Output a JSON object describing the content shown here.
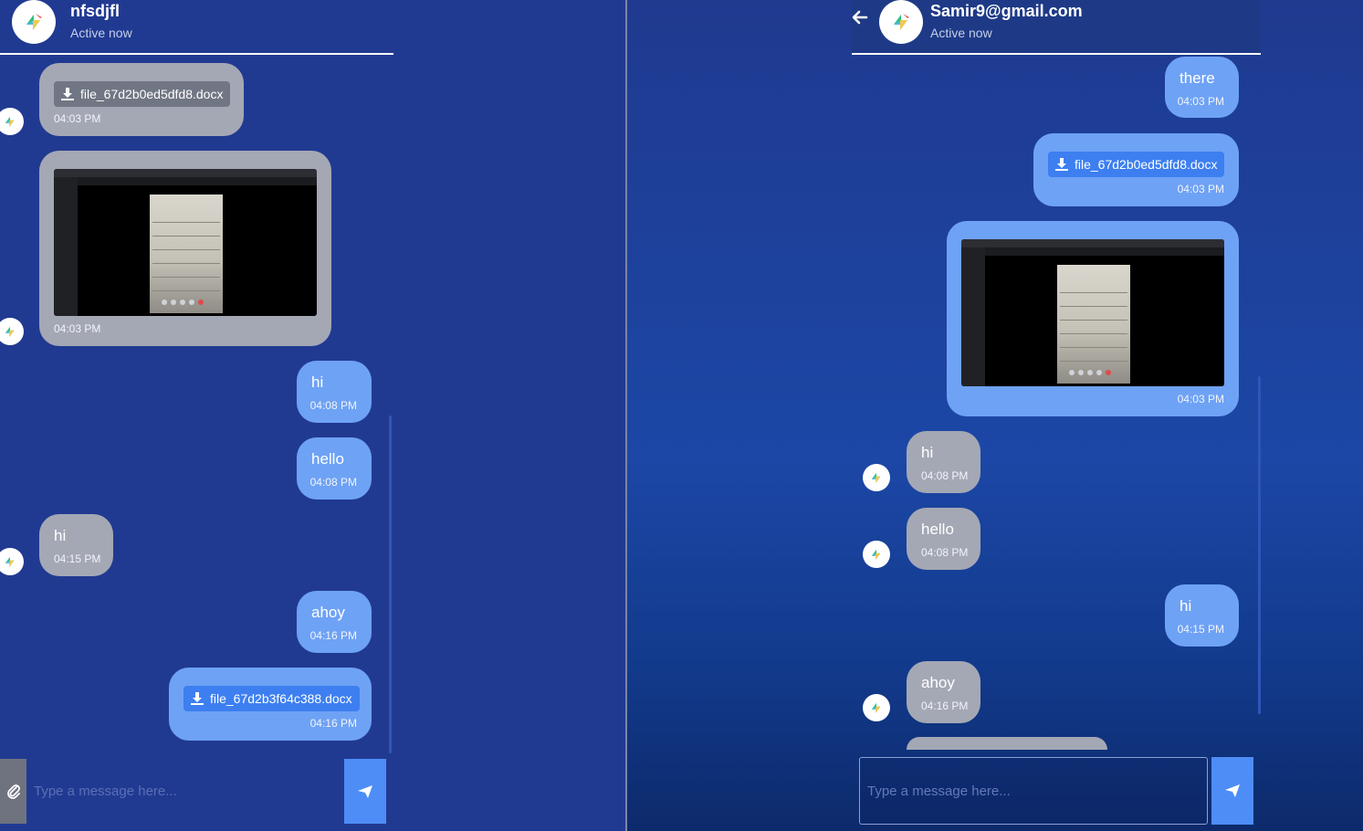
{
  "left": {
    "header": {
      "name": "nfsdjfl",
      "status": "Active now"
    },
    "composer": {
      "placeholder": "Type a message here..."
    },
    "messages": [
      {
        "file": "file_67d2b0ed5dfd8.docx",
        "time": "04:03 PM"
      },
      {
        "time": "04:03 PM"
      },
      {
        "text": "hi",
        "time": "04:08 PM"
      },
      {
        "text": "hello",
        "time": "04:08 PM"
      },
      {
        "text": "hi",
        "time": "04:15 PM"
      },
      {
        "text": "ahoy",
        "time": "04:16 PM"
      },
      {
        "file": "file_67d2b3f64c388.docx",
        "time": "04:16 PM"
      }
    ]
  },
  "right": {
    "header": {
      "name": "Samir9@gmail.com",
      "status": "Active now"
    },
    "composer": {
      "placeholder": "Type a message here..."
    },
    "messages": [
      {
        "text": "there",
        "time": "04:03 PM"
      },
      {
        "file": "file_67d2b0ed5dfd8.docx",
        "time": "04:03 PM"
      },
      {
        "time": "04:03 PM"
      },
      {
        "text": "hi",
        "time": "04:08 PM"
      },
      {
        "text": "hello",
        "time": "04:08 PM"
      },
      {
        "text": "hi",
        "time": "04:15 PM"
      },
      {
        "text": "ahoy",
        "time": "04:16 PM"
      }
    ]
  },
  "icons": {
    "avatar": "logo-icon",
    "download": "download-icon",
    "attach": "paperclip-icon",
    "send": "send-icon",
    "back": "arrow-left-icon"
  },
  "colors": {
    "incoming_bubble": "#a4a8b5",
    "outgoing_bubble": "#6ea2f5",
    "send_button": "#4d8df5",
    "background": "#213a91"
  }
}
